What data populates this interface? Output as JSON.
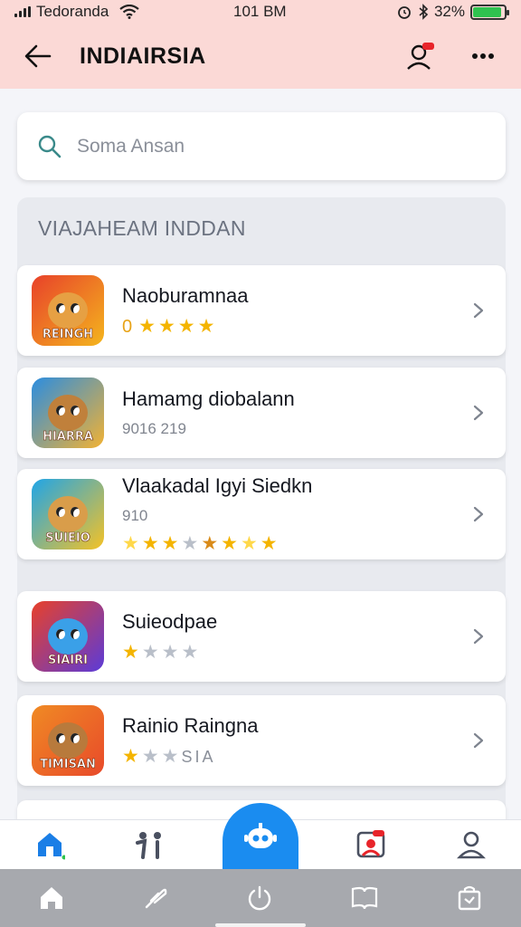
{
  "status_bar": {
    "carrier": "Tedoranda",
    "time": "101 BM",
    "battery": "32%",
    "battery_level": 0.9
  },
  "header": {
    "title": "INDIAIRSIA",
    "back_icon": "arrow-left-icon",
    "profile_icon": "user-icon",
    "more_icon": "more-horizontal-icon"
  },
  "search": {
    "placeholder": "Soma Ansan",
    "value": ""
  },
  "section": {
    "title": "VIAJAHEAM INDDAN"
  },
  "games": [
    {
      "name": "Naoburamnaa",
      "sub": "",
      "badge": "REINGH",
      "rating_text": "0",
      "stars": [
        "full",
        "full",
        "full",
        "full"
      ],
      "colors": [
        "#e8412a",
        "#f4b51e"
      ]
    },
    {
      "name": "Hamamg diobalann",
      "sub": "9016 219",
      "badge": "HIARRA",
      "rating_text": "",
      "stars": [],
      "colors": [
        "#2b8de0",
        "#f2b233"
      ]
    },
    {
      "name": "Vlaakadal Igyi Siedkn",
      "sub": "910",
      "badge": "SUIEIO",
      "rating_text": "",
      "stars": [
        "light",
        "full",
        "full",
        "gray",
        "dark",
        "full",
        "light",
        "full"
      ],
      "colors": [
        "#1fa5e8",
        "#f5c225"
      ]
    },
    {
      "name": "Suieodpae",
      "sub": "",
      "badge": "SIAIRI",
      "rating_text": "",
      "stars": [
        "full",
        "gray",
        "gray",
        "gray"
      ],
      "colors": [
        "#e8412a",
        "#5b3bd8"
      ]
    },
    {
      "name": "Rainio Raingna",
      "sub": "",
      "badge": "TIMISAN",
      "rating_text": "SIA",
      "stars": [
        "full",
        "gray",
        "gray"
      ],
      "colors": [
        "#f08a24",
        "#e84a2a"
      ]
    }
  ],
  "bottom_nav": {
    "items": [
      "home-icon",
      "people-icon",
      "robot-icon",
      "chat-icon",
      "profile-icon"
    ]
  },
  "colors": {
    "header_bg": "#fbd9d6",
    "accent": "#1a8cf0",
    "star": "#f4b400"
  }
}
